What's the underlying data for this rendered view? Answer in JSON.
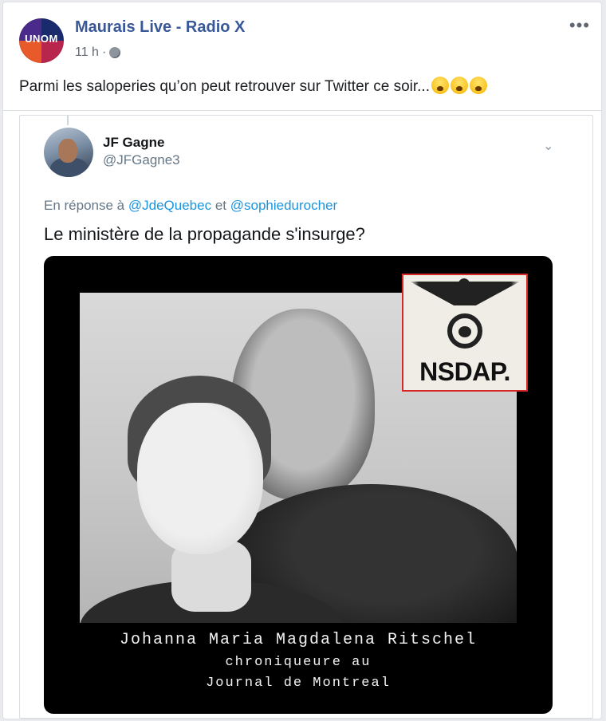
{
  "post": {
    "page_name": "Maurais Live - Radio X",
    "avatar_text": "UNOM",
    "time": "11 h",
    "dot": "·",
    "text": "Parmi les saloperies qu’on peut retrouver sur Twitter ce soir...",
    "emoji_count": 3,
    "more_icon": "•••"
  },
  "tweet": {
    "name": "JF Gagne",
    "handle": "@JFGagne3",
    "chevron": "⌄",
    "reply_prefix": "En réponse à",
    "reply_user1": "@JdeQuebec",
    "reply_and": "et",
    "reply_user2": "@sophiedurocher",
    "text": "Le ministère de la propagande s'insurge?",
    "image": {
      "emblem_label": "NSDAP.",
      "caption_line1": "Johanna Maria Magdalena Ritschel",
      "caption_line2": "chroniqueure au",
      "caption_line3": "Journal de Montreal"
    }
  }
}
